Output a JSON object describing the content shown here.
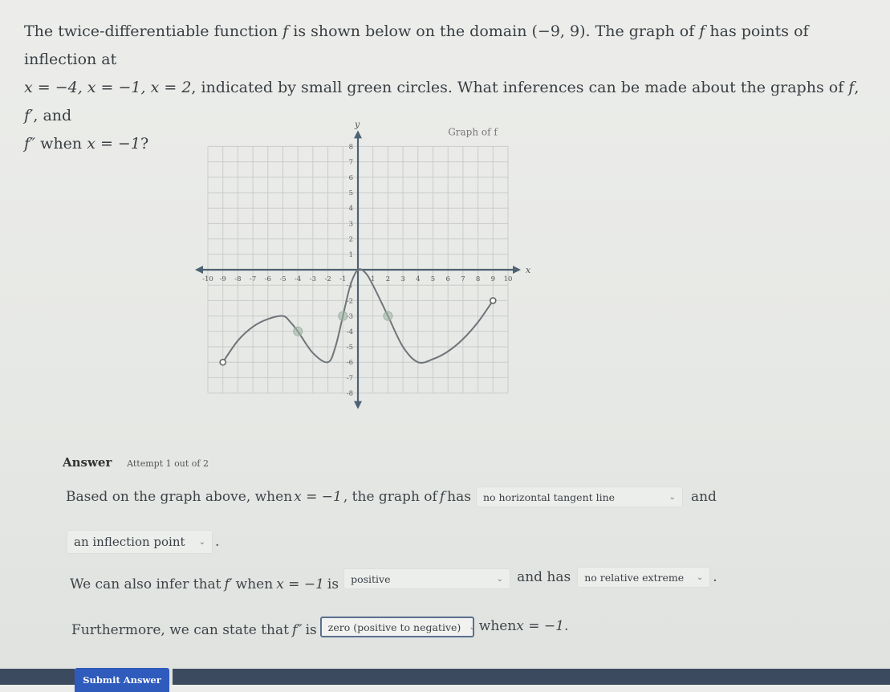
{
  "question": {
    "line1_a": "The twice-differentiable function ",
    "f": "f",
    "line1_b": " is shown below on the domain ",
    "domain": "(−9, 9)",
    "line1_c": ". The graph of ",
    "line1_d": " has points of inflection at",
    "line2_points": "x = −4, x = −1, x = 2",
    "line2_a": ", indicated by small green circles. What inferences can be made about the graphs of ",
    "f_prime": "f′",
    "line2_b": ", and",
    "f_double_prime": "f″",
    "line3_a": " when ",
    "line3_eq": "x = −1",
    "line3_b": "?"
  },
  "chart_data": {
    "type": "line",
    "title": "Graph of f",
    "xlabel": "x",
    "ylabel": "y",
    "xlim": [
      -10,
      10
    ],
    "ylim": [
      -8,
      8
    ],
    "x_ticks": [
      -10,
      -9,
      -8,
      -7,
      -6,
      -5,
      -4,
      -3,
      -2,
      -1,
      1,
      2,
      3,
      4,
      5,
      6,
      7,
      8,
      9,
      10
    ],
    "y_ticks": [
      -8,
      -7,
      -6,
      -5,
      -4,
      -3,
      -2,
      -1,
      1,
      2,
      3,
      4,
      5,
      6,
      7,
      8
    ],
    "grid": true,
    "series": [
      {
        "name": "f",
        "points": [
          [
            -9,
            -6
          ],
          [
            -8,
            -4.6
          ],
          [
            -7,
            -3.7
          ],
          [
            -6,
            -3.2
          ],
          [
            -5,
            -3
          ],
          [
            -4.5,
            -3.4
          ],
          [
            -4,
            -4
          ],
          [
            -3,
            -5.4
          ],
          [
            -2,
            -6
          ],
          [
            -1.5,
            -5
          ],
          [
            -1,
            -3
          ],
          [
            -0.5,
            -1
          ],
          [
            0,
            0
          ],
          [
            0.5,
            -0.2
          ],
          [
            1,
            -1
          ],
          [
            2,
            -3
          ],
          [
            3,
            -5
          ],
          [
            4,
            -6
          ],
          [
            5,
            -5.8
          ],
          [
            6,
            -5.3
          ],
          [
            7,
            -4.5
          ],
          [
            8,
            -3.4
          ],
          [
            9,
            -2
          ]
        ],
        "open_endpoints": [
          [
            -9,
            -6
          ],
          [
            9,
            -2
          ]
        ]
      }
    ],
    "inflection_points": [
      [
        -4,
        -4
      ],
      [
        -1,
        -3
      ],
      [
        2,
        -3
      ]
    ],
    "colors": {
      "curve": "#6f7479",
      "axis": "#4d6272",
      "grid": "#c9cccb",
      "inflection": "#9eb3a2"
    }
  },
  "answer": {
    "title": "Answer",
    "attempt": "Attempt 1 out of 2",
    "s1_a": "Based on the graph above, when ",
    "s1_eq": "x = −1",
    "s1_b": ", the graph of ",
    "s1_c": " has",
    "select1": "no horizontal tangent line",
    "s1_d": "and",
    "select2": "an inflection point",
    "s2_a": "We can also infer that ",
    "s2_b": " when ",
    "s2_c": " is",
    "select3": "positive",
    "s2_d": "and has",
    "select4": "no relative extreme",
    "s3_a": "Furthermore, we can state that ",
    "s3_b": " is",
    "select5": "zero (positive to negative)",
    "s3_c": "when ",
    "submit": "Submit Answer",
    "period": "."
  }
}
